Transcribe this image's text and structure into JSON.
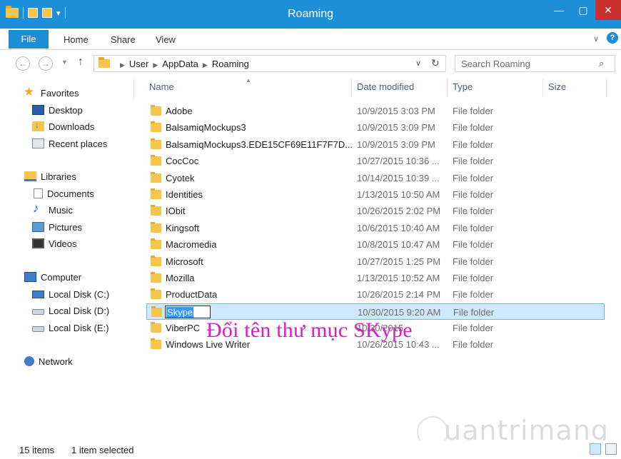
{
  "window": {
    "title": "Roaming"
  },
  "ribbon": {
    "tabs": [
      "File",
      "Home",
      "Share",
      "View"
    ]
  },
  "address": {
    "crumbs": [
      "User",
      "AppData",
      "Roaming"
    ]
  },
  "search": {
    "placeholder": "Search Roaming"
  },
  "sidebar": {
    "favorites": {
      "label": "Favorites",
      "items": [
        "Desktop",
        "Downloads",
        "Recent places"
      ]
    },
    "libraries": {
      "label": "Libraries",
      "items": [
        "Documents",
        "Music",
        "Pictures",
        "Videos"
      ]
    },
    "computer": {
      "label": "Computer",
      "items": [
        "Local Disk (C:)",
        "Local Disk (D:)",
        "Local Disk (E:)"
      ]
    },
    "network": {
      "label": "Network"
    }
  },
  "columns": {
    "name": "Name",
    "date": "Date modified",
    "type": "Type",
    "size": "Size"
  },
  "files": [
    {
      "name": "Adobe",
      "date": "10/9/2015 3:03 PM",
      "type": "File folder"
    },
    {
      "name": "BalsamiqMockups3",
      "date": "10/9/2015 3:09 PM",
      "type": "File folder"
    },
    {
      "name": "BalsamiqMockups3.EDE15CF69E11F7F7D...",
      "date": "10/9/2015 3:09 PM",
      "type": "File folder"
    },
    {
      "name": "CocCoc",
      "date": "10/27/2015 10:36 ...",
      "type": "File folder"
    },
    {
      "name": "Cyotek",
      "date": "10/14/2015 10:39 ...",
      "type": "File folder"
    },
    {
      "name": "Identities",
      "date": "1/13/2015 10:50 AM",
      "type": "File folder"
    },
    {
      "name": "IObit",
      "date": "10/26/2015 2:02 PM",
      "type": "File folder"
    },
    {
      "name": "Kingsoft",
      "date": "10/6/2015 10:40 AM",
      "type": "File folder"
    },
    {
      "name": "Macromedia",
      "date": "10/8/2015 10:47 AM",
      "type": "File folder"
    },
    {
      "name": "Microsoft",
      "date": "10/27/2015 1:25 PM",
      "type": "File folder"
    },
    {
      "name": "Mozilla",
      "date": "1/13/2015 10:52 AM",
      "type": "File folder"
    },
    {
      "name": "ProductData",
      "date": "10/26/2015 2:14 PM",
      "type": "File folder"
    },
    {
      "name": "Skype",
      "date": "10/30/2015 9:20 AM",
      "type": "File folder",
      "selected": true,
      "renaming": true
    },
    {
      "name": "ViberPC",
      "date": "10/30/2015 ",
      "type": "File folder"
    },
    {
      "name": "Windows Live Writer",
      "date": "10/26/2015 10:43 ...",
      "type": "File folder"
    }
  ],
  "annotation": "Đổi tên thư mục SKype",
  "watermark": "uantrimang",
  "status": {
    "count": "15 items",
    "selection": "1 item selected"
  },
  "colors": {
    "accent": "#1c8fd8",
    "selection": "#cde8ff",
    "annotation": "#d81cc8",
    "close": "#c7302c"
  }
}
